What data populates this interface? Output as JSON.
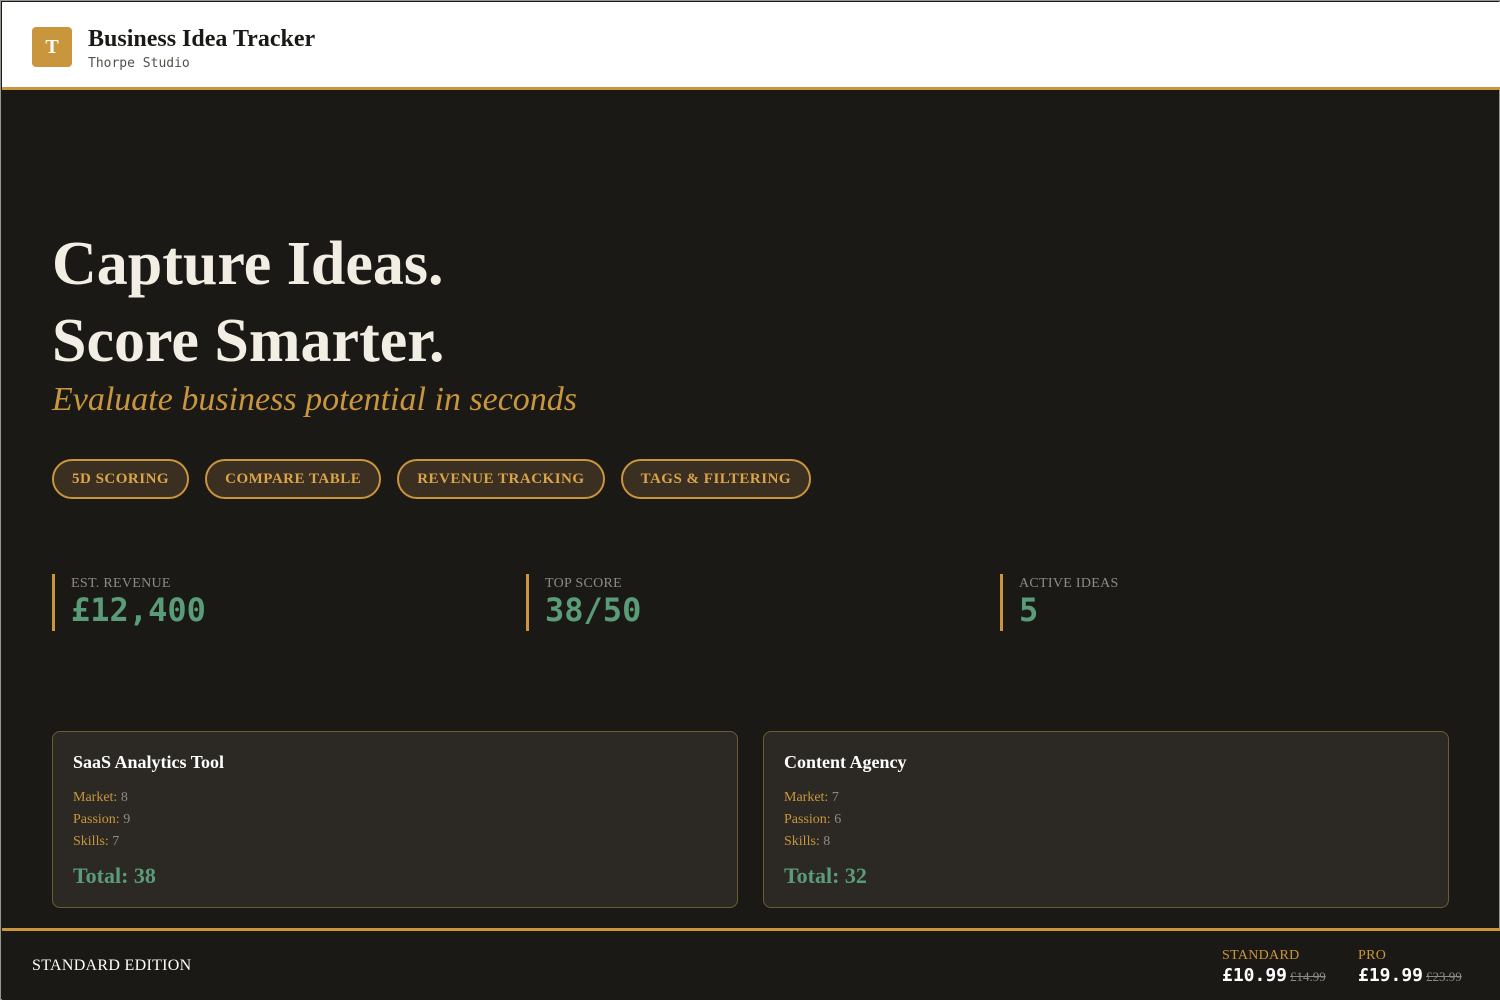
{
  "header": {
    "logo_letter": "T",
    "title": "Business Idea Tracker",
    "subtitle": "Thorpe Studio"
  },
  "hero": {
    "line1": "Capture Ideas.",
    "line2": "Score Smarter.",
    "tagline": "Evaluate business potential in seconds"
  },
  "features": [
    "5D SCORING",
    "COMPARE TABLE",
    "REVENUE TRACKING",
    "TAGS & FILTERING"
  ],
  "stats": [
    {
      "label": "EST. REVENUE",
      "value": "£12,400"
    },
    {
      "label": "TOP SCORE",
      "value": "38/50"
    },
    {
      "label": "ACTIVE IDEAS",
      "value": "5"
    }
  ],
  "cards": [
    {
      "title": "SaaS Analytics Tool",
      "metrics": [
        {
          "label": "Market:",
          "value": "8"
        },
        {
          "label": "Passion:",
          "value": "9"
        },
        {
          "label": "Skills:",
          "value": "7"
        }
      ],
      "total": "Total: 38"
    },
    {
      "title": "Content Agency",
      "metrics": [
        {
          "label": "Market:",
          "value": "7"
        },
        {
          "label": "Passion:",
          "value": "6"
        },
        {
          "label": "Skills:",
          "value": "8"
        }
      ],
      "total": "Total: 32"
    }
  ],
  "footer": {
    "edition": "STANDARD EDITION",
    "plans": [
      {
        "label": "STANDARD",
        "price": "£10.99",
        "was": "£14.99"
      },
      {
        "label": "PRO",
        "price": "£19.99",
        "was": "£23.99"
      }
    ]
  },
  "colors": {
    "accent": "#c9963d",
    "background": "#1b1916",
    "positive": "#5a9c78",
    "card": "#2c2925"
  }
}
